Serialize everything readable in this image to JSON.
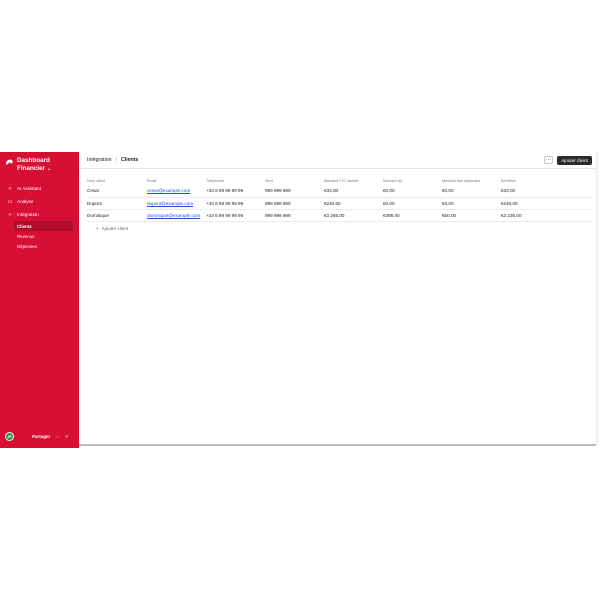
{
  "sidebar": {
    "brand_line1": "Dashboard",
    "brand_line2": "Financier",
    "items": [
      {
        "label": "AI Assistant",
        "icon": "sparkle-icon"
      },
      {
        "label": "Analyse",
        "icon": "folder-icon"
      },
      {
        "label": "Intégration",
        "icon": "code-icon"
      }
    ],
    "subitems": [
      {
        "label": "Clients",
        "active": true
      },
      {
        "label": "Revenus",
        "active": false
      },
      {
        "label": "Dépenses",
        "active": false
      }
    ],
    "footer": {
      "avatar": "JE",
      "share_label": "Partager"
    }
  },
  "header": {
    "breadcrumb_parent": "Intégration",
    "breadcrumb_sep": "/",
    "breadcrumb_current": "Clients",
    "more_label": "···",
    "add_client_label": "Ajouter client"
  },
  "table": {
    "columns": [
      "Nom client",
      "Email",
      "Téléphone",
      "Siret",
      "Montant TTC factuté",
      "Montant dû",
      "Montant des dépenses",
      "Bénéfice"
    ],
    "rows": [
      [
        "Cesar",
        "cesar@example.com",
        "+33 6 99 99 99 99",
        "999 999 999",
        "€33,00",
        "€0,00",
        "€0,00",
        "€33,00"
      ],
      [
        "Dupont",
        "dupont@example.com",
        "+33 6 99 99 99 99",
        "999 999 999",
        "€240,00",
        "€0,00",
        "€0,00",
        "€240,00"
      ],
      [
        "Dominique",
        "dominique@example.com",
        "+33 6 99 99 99 99",
        "999 999 999",
        "€3 285,00",
        "€395,00",
        "€50,00",
        "€3 235,00"
      ]
    ],
    "add_row_label": "Ajouter client"
  },
  "colors": {
    "sidebar": "#d70f35",
    "primary_button": "#2a2a2a",
    "link": "#1a55d9"
  }
}
